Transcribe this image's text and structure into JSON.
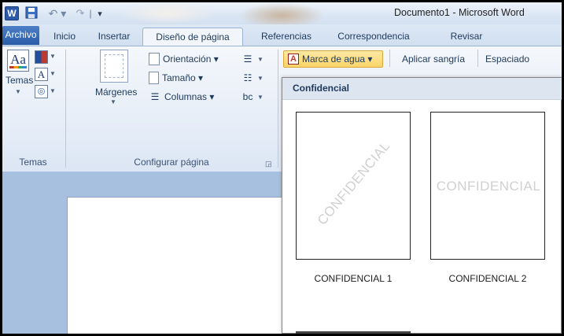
{
  "app": {
    "icon_letter": "W",
    "title": "Documento1 - Microsoft Word"
  },
  "qat": {
    "undo": "↶ ▾",
    "redo": "↷",
    "separator": "|",
    "customize": "▾"
  },
  "tabs": [
    {
      "label": "Archivo"
    },
    {
      "label": "Inicio"
    },
    {
      "label": "Insertar"
    },
    {
      "label": "Diseño de página"
    },
    {
      "label": "Referencias"
    },
    {
      "label": "Correspondencia"
    },
    {
      "label": "Revisar"
    }
  ],
  "ribbon": {
    "temas_group": {
      "temas_button": "Temas",
      "temas_icon_text": "Aa",
      "fonts_icon_text": "A",
      "group_label": "Temas"
    },
    "page_setup_group": {
      "margenes": "Márgenes",
      "orientacion": "Orientación ▾",
      "tamano": "Tamaño ▾",
      "columnas": "Columnas ▾",
      "hyphenation_icon_text": "bc",
      "group_label": "Configurar página"
    },
    "background_group": {
      "marca_de_agua": "Marca de agua ▾"
    },
    "paragraph": {
      "aplicar_sangria": "Aplicar sangría",
      "espaciado": "Espaciado"
    }
  },
  "watermark_gallery": {
    "header": "Confidencial",
    "items": [
      {
        "watermark": "CONFIDENCIAL",
        "caption": "CONFIDENCIAL 1",
        "style": "diagonal"
      },
      {
        "watermark": "CONFIDENCIAL",
        "caption": "CONFIDENCIAL 2",
        "style": "horizontal"
      }
    ]
  },
  "colors": {
    "archivo_tab": "#2a5ba6",
    "highlight": "#fbd46a",
    "ribbon_bg": "#e4ecf7",
    "doc_bg": "#a8c0df"
  }
}
